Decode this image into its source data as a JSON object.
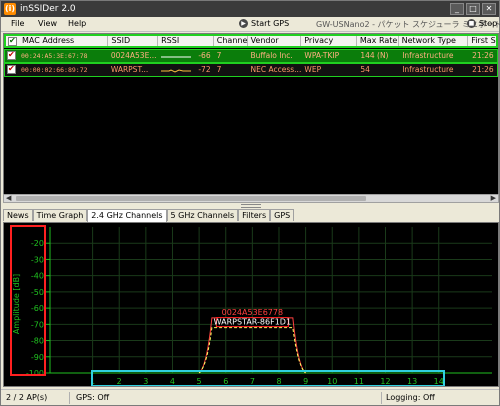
{
  "window": {
    "title": "inSSIDer 2.0",
    "app_icon": "(i)",
    "controls": [
      "_",
      "□",
      "✕"
    ]
  },
  "menu": {
    "items": [
      "File",
      "View",
      "Help"
    ],
    "start_gps": "Start GPS",
    "adapter": "GW-USNano2 - パケット スケジューラ ミニポート -",
    "stop": "Stop"
  },
  "table": {
    "columns": [
      "MAC Address",
      "SSID",
      "RSSI",
      "Channel",
      "Vendor",
      "Privacy",
      "Max Rate",
      "Network Type",
      "First S"
    ],
    "rows": [
      {
        "mac": "00:24:A5:3E:67:78",
        "ssid": "0024A53E...",
        "rssi": "-66",
        "channel": "7",
        "vendor": "Buffalo Inc.",
        "privacy": "WPA-TKIP",
        "max_rate": "144 (N)",
        "network_type": "Infrastructure",
        "first_seen": "21:26"
      },
      {
        "mac": "00:00:02:66:89:72",
        "ssid": "WARPST...",
        "rssi": "-72",
        "channel": "7",
        "vendor": "NEC Access...",
        "privacy": "WEP",
        "max_rate": "54",
        "network_type": "Infrastructure",
        "first_seen": "21:26"
      }
    ]
  },
  "tabs": [
    "News",
    "Time Graph",
    "2.4 GHz Channels",
    "5 GHz Channels",
    "Filters",
    "GPS"
  ],
  "active_tab": "2.4 GHz Channels",
  "status": {
    "ap_count": "2 / 2 AP(s)",
    "gps": "GPS: Off",
    "logging": "Logging: Off"
  },
  "colors": {
    "row1_bg": "#0b7d0b",
    "network1": "#ff4040",
    "network2": "#ffff60",
    "highlight_y": "#ff2020",
    "highlight_x": "#30d0e0",
    "axis": "#20c020"
  },
  "chart_data": {
    "type": "area",
    "ylabel": "Amplitude [dB]",
    "y_ticks": [
      "-20",
      "-30",
      "-40",
      "-50",
      "-60",
      "-70",
      "-80",
      "-90",
      "-100"
    ],
    "ylim": [
      -100,
      -10
    ],
    "x_ticks": [
      "1",
      "2",
      "3",
      "4",
      "5",
      "6",
      "7",
      "8",
      "9",
      "10",
      "11",
      "12",
      "13",
      "14"
    ],
    "series": [
      {
        "name": "0024A53E6778",
        "center_channel": 7,
        "width_channels": [
          5,
          9
        ],
        "rssi": -66
      },
      {
        "name": "WARPSTAR-86F1D1",
        "center_channel": 7,
        "width_channels": [
          5,
          9
        ],
        "rssi": -72
      }
    ],
    "grid": true
  }
}
